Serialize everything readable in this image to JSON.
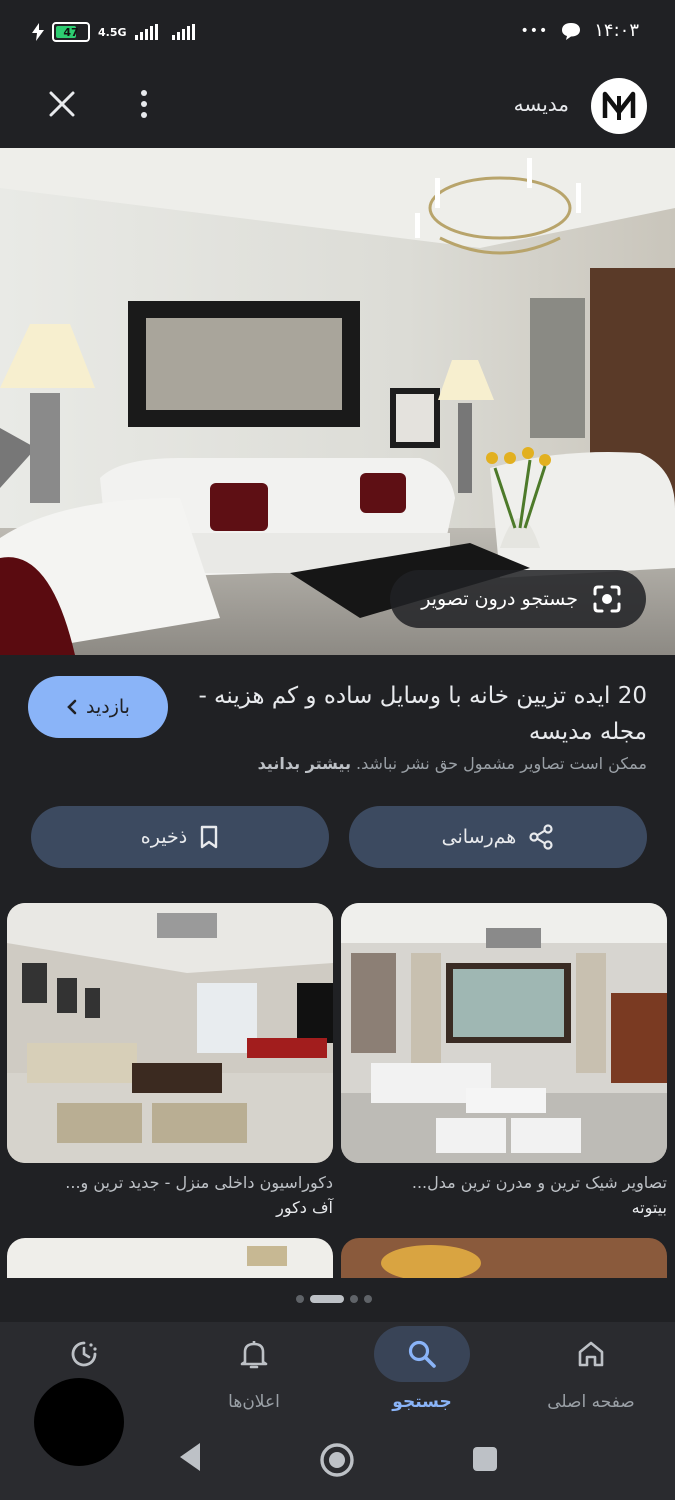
{
  "status_bar": {
    "battery": "47",
    "network": "4.5G",
    "time": "۱۴:۰۳",
    "more": "•••"
  },
  "header": {
    "site_name": "مدیسه"
  },
  "hero": {
    "lens_label": "جستجو درون تصویر"
  },
  "result": {
    "title": "20 ایده تزیین خانه با وسایل ساده و کم هزینه - مجله مدیسه",
    "visit_label": "بازدید",
    "copyright_text": "ممکن است تصاویر مشمول حق نشر نباشد.",
    "learn_more": "بیشتر بدانید",
    "share_label": "هم‌رسانی",
    "save_label": "ذخیره"
  },
  "related": [
    {
      "caption": "تصاویر شیک ترین و مدرن ترین مدل...",
      "source": "بیتوته"
    },
    {
      "caption": "دکوراسیون داخلی منزل - جدید ترین و...",
      "source": "آف دکور"
    }
  ],
  "bottom_nav": [
    {
      "label": "صفحه اصلی",
      "icon": "home-icon"
    },
    {
      "label": "جستجو",
      "icon": "search-icon",
      "active": true
    },
    {
      "label": "اعلان‌ها",
      "icon": "bell-icon"
    },
    {
      "label": "",
      "icon": "history-icon"
    }
  ],
  "colors": {
    "accent": "#8ab4f8",
    "background": "#202124",
    "button": "#3c4a60"
  }
}
